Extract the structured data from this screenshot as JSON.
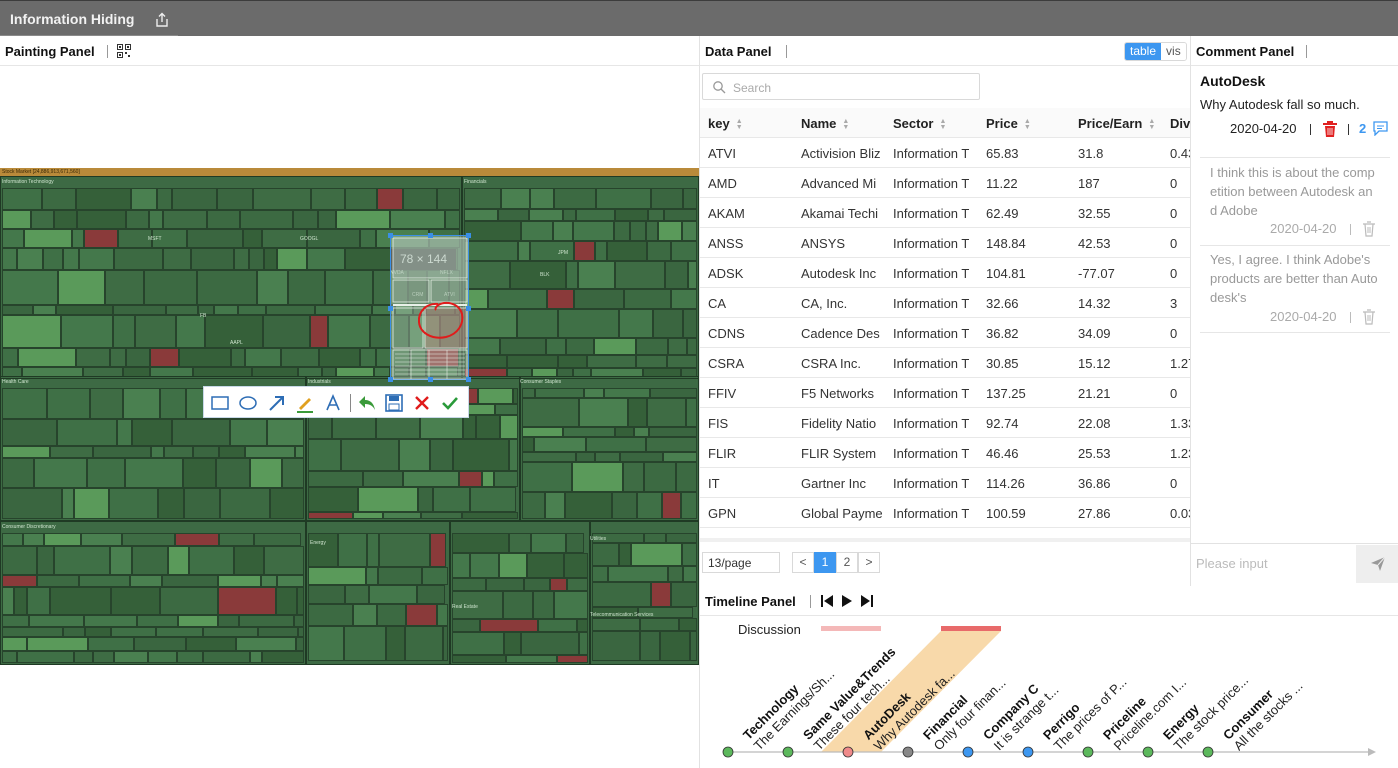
{
  "app": {
    "title": "Information Hiding"
  },
  "painting": {
    "title": "Painting Panel",
    "size_tip": "78 × 144",
    "treemap_labels": [
      "Stock Market [24,886,913,671,560]",
      "Information Technology",
      "Financials",
      "Health Care",
      "Industrials",
      "Consumer Staples",
      "Consumer Discretionary",
      "Energy",
      "Utilities",
      "Real Estate",
      "Telecommunication Services",
      "GOOGL",
      "AAPL",
      "MSFT",
      "FB",
      "NVDA",
      "NFLX",
      "CRM",
      "ATVI",
      "JPM",
      "BLK"
    ]
  },
  "data_panel": {
    "title": "Data Panel",
    "toggle": {
      "table": "table",
      "vis": "vis"
    },
    "search_placeholder": "Search",
    "columns": [
      "key",
      "Name",
      "Sector",
      "Price",
      "Price/Earn",
      "Div"
    ],
    "rows": [
      [
        "ATVI",
        "Activision Bliz",
        "Information T",
        "65.83",
        "31.8",
        "0.43"
      ],
      [
        "AMD",
        "Advanced Mi",
        "Information T",
        "11.22",
        "187",
        "0"
      ],
      [
        "AKAM",
        "Akamai Techi",
        "Information T",
        "62.49",
        "32.55",
        "0"
      ],
      [
        "ANSS",
        "ANSYS",
        "Information T",
        "148.84",
        "42.53",
        "0"
      ],
      [
        "ADSK",
        "Autodesk Inc",
        "Information T",
        "104.81",
        "-77.07",
        "0"
      ],
      [
        "CA",
        "CA, Inc.",
        "Information T",
        "32.66",
        "14.32",
        "3"
      ],
      [
        "CDNS",
        "Cadence Des",
        "Information T",
        "36.82",
        "34.09",
        "0"
      ],
      [
        "CSRA",
        "CSRA Inc.",
        "Information T",
        "30.85",
        "15.12",
        "1.27"
      ],
      [
        "FFIV",
        "F5 Networks",
        "Information T",
        "137.25",
        "21.21",
        "0"
      ],
      [
        "FIS",
        "Fidelity Natio",
        "Information T",
        "92.74",
        "22.08",
        "1.33"
      ],
      [
        "FLIR",
        "FLIR System",
        "Information T",
        "46.46",
        "25.53",
        "1.23"
      ],
      [
        "IT",
        "Gartner Inc",
        "Information T",
        "114.26",
        "36.86",
        "0"
      ],
      [
        "GPN",
        "Global Payme",
        "Information T",
        "100.59",
        "27.86",
        "0.03"
      ]
    ],
    "page_size": "13/page",
    "pages": [
      "<",
      "1",
      "2",
      ">"
    ]
  },
  "comment_panel": {
    "title": "Comment Panel",
    "main": {
      "title": "AutoDesk",
      "text": "Why Autodesk fall so much.",
      "date": "2020-04-20",
      "reply_count": "2"
    },
    "replies": [
      {
        "text": "I think this is about the competition between Autodesk and Adobe",
        "date": "2020-04-20"
      },
      {
        "text": "Yes, I agree. I think Adobe's products are better than Autodesk's",
        "date": "2020-04-20"
      }
    ],
    "input_placeholder": "Please input"
  },
  "timeline": {
    "title": "Timeline Panel",
    "discussion_label": "Discussion",
    "events": [
      {
        "title": "Technology",
        "text": "The Earnings/Sh...",
        "color": "#5cb85c"
      },
      {
        "title": "Same Value&Trends",
        "text": "These four tech...",
        "color": "#5cb85c"
      },
      {
        "title": "AutoDesk",
        "text": "Why Autodesk fa...",
        "color": "#f08a8a"
      },
      {
        "title": "Financial",
        "text": "Only four finan...",
        "color": "#888888"
      },
      {
        "title": "Company C",
        "text": "It is strange t...",
        "color": "#3d97f0"
      },
      {
        "title": "Perrigo",
        "text": "The prices of P...",
        "color": "#3d97f0"
      },
      {
        "title": "Priceline",
        "text": "Priceline.com I...",
        "color": "#5cb85c"
      },
      {
        "title": "Energy",
        "text": "The stock price...",
        "color": "#5cb85c"
      },
      {
        "title": "Consumer",
        "text": "All the stocks ...",
        "color": "#5cb85c"
      }
    ]
  }
}
